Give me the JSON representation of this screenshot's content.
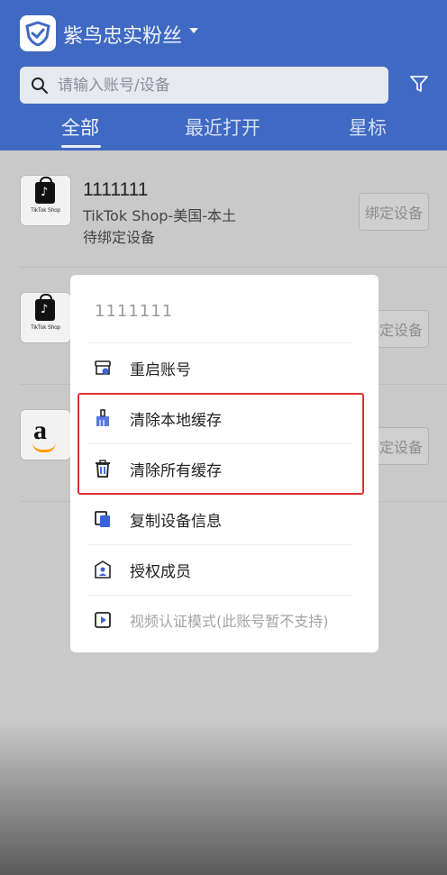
{
  "header": {
    "app_title": "紫鸟忠实粉丝",
    "search_placeholder": "请输入账号/设备",
    "tabs": [
      {
        "label": "全部",
        "active": true
      },
      {
        "label": "最近打开",
        "active": false
      },
      {
        "label": "星标",
        "active": false
      }
    ]
  },
  "accounts": [
    {
      "icon": "tiktok-shop-icon",
      "icon_text": "TikTok Shop",
      "name": "1111111",
      "platform": "TikTok Shop-美国-本土",
      "status": "待绑定设备",
      "action": "绑定设备"
    },
    {
      "icon": "tiktok-shop-icon",
      "icon_text": "TikTok Shop",
      "action": "绑定设备"
    },
    {
      "icon": "amazon-icon",
      "icon_text": "a",
      "action": "绑定设备"
    }
  ],
  "menu": {
    "title": "1111111",
    "items": [
      {
        "label": "重启账号",
        "icon": "shop-restart-icon"
      },
      {
        "label": "清除本地缓存",
        "icon": "broom-icon"
      },
      {
        "label": "清除所有缓存",
        "icon": "trash-icon"
      },
      {
        "label": "复制设备信息",
        "icon": "copy-icon"
      },
      {
        "label": "授权成员",
        "icon": "authorize-member-icon"
      },
      {
        "label": "视频认证模式(此账号暂不支持)",
        "icon": "video-auth-icon",
        "disabled": true
      }
    ]
  },
  "colors": {
    "header": "#3f69c2",
    "accent": "#3a63d8",
    "highlight": "#e03030"
  }
}
